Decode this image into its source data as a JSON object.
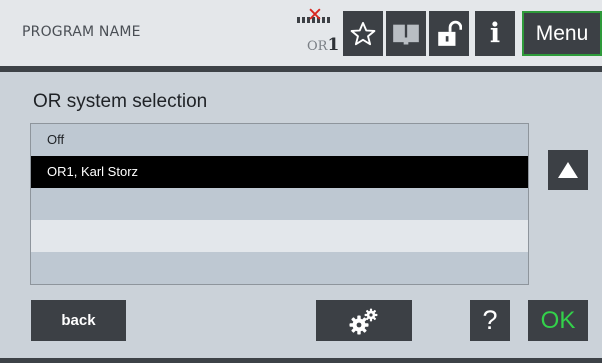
{
  "header": {
    "program_name": "PROGRAM NAME",
    "or_indicator": {
      "prefix": "OR",
      "number": "1"
    },
    "icons": [
      "star-icon",
      "book-icon",
      "unlock-icon",
      "info-icon"
    ],
    "info_label": "i",
    "menu_label": "Menu"
  },
  "main": {
    "title": "OR system selection",
    "list": {
      "items": [
        {
          "label": "Off",
          "selected": false
        },
        {
          "label": "OR1, Karl Storz",
          "selected": true
        },
        {
          "label": "",
          "selected": false
        },
        {
          "label": "",
          "selected": false
        },
        {
          "label": "",
          "selected": false
        }
      ]
    }
  },
  "footer": {
    "back_label": "back",
    "help_label": "?",
    "ok_label": "OK"
  },
  "colors": {
    "header_bg": "#e4e7ea",
    "button_bg": "#3c4045",
    "menu_border": "#2e9a3a",
    "ok_text": "#33d14a",
    "disconnected_x": "#d8261f",
    "selected_row": "#000000"
  }
}
